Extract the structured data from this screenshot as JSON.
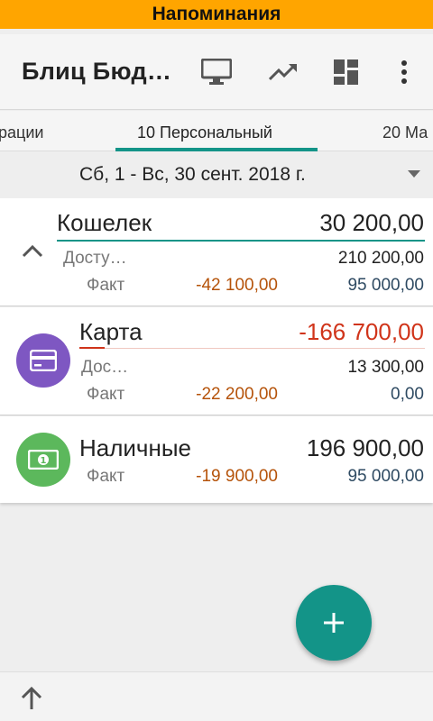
{
  "banner": {
    "text": "Напоминания"
  },
  "appbar": {
    "title": "Блиц Бюд…",
    "icons": [
      "monitor-icon",
      "trending-up-icon",
      "dashboard-icon",
      "more-vert-icon"
    ]
  },
  "tabs": [
    {
      "label": "рации"
    },
    {
      "label": "10 Персональный"
    },
    {
      "label": "20 Ма"
    }
  ],
  "period": {
    "text": "Сб, 1 - Вс, 30 сент. 2018 г."
  },
  "accounts": [
    {
      "name": "Кошелек",
      "total": "30 200,00",
      "available_label": "Досту…",
      "available_value": "210 200,00",
      "fact_label": "Факт",
      "fact_value": "-42 100,00",
      "plan_value": "95 000,00"
    },
    {
      "name": "Карта",
      "total": "-166 700,00",
      "available_label": "Дос…",
      "available_value": "13 300,00",
      "fact_label": "Факт",
      "fact_value": "-22 200,00",
      "plan_value": "0,00"
    },
    {
      "name": "Наличные",
      "total": "196 900,00",
      "fact_label": "Факт",
      "fact_value": "-19 900,00",
      "plan_value": "95 000,00"
    }
  ],
  "colors": {
    "banner": "#ffa500",
    "accent": "#139488",
    "negative": "#d0341a",
    "fact": "#b5530a",
    "plan": "#2e4a62",
    "card_avatar": "#7e57c2",
    "cash_avatar": "#5cb85c"
  }
}
